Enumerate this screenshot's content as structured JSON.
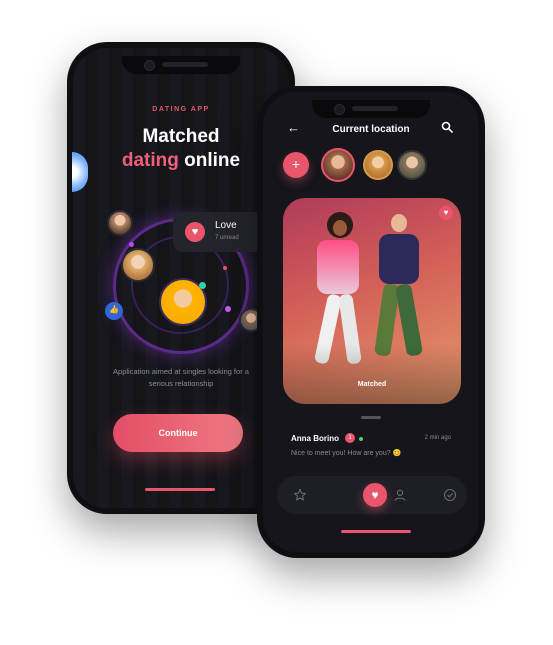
{
  "screen1": {
    "kicker": "DATING APP",
    "headline_line1": "Matched",
    "headline_accent": "dating",
    "headline_rest": " online",
    "notification": {
      "title": "Love",
      "subtitle": "7 unread"
    },
    "description": "Application aimed at singles looking for a serious relationship",
    "continue_label": "Continue"
  },
  "screen2": {
    "title": "Current location",
    "photo_label": "Matched",
    "message": {
      "name": "Anna Borino",
      "badge": "1",
      "time": "2 min ago",
      "text": "Nice to meet you! How are you? 😊"
    }
  },
  "colors": {
    "accent": "#e9566c",
    "background": "#15151b"
  }
}
